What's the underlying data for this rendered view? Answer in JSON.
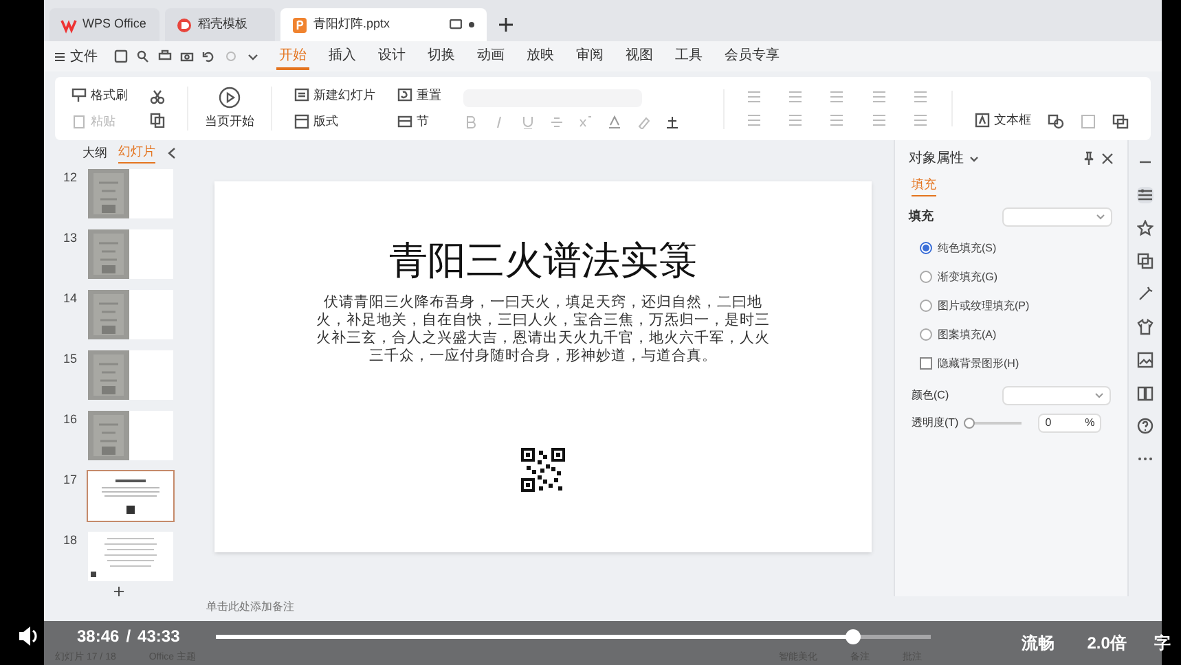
{
  "doc_tabs": [
    {
      "label": "WPS Office",
      "kind": "wps",
      "selected": false
    },
    {
      "label": "稻壳模板",
      "kind": "docer",
      "selected": false
    },
    {
      "label": "青阳灯阵.pptx",
      "kind": "pptx",
      "selected": true
    }
  ],
  "menu": {
    "file": "文件",
    "tabs": [
      {
        "label": "开始",
        "selected": true
      },
      {
        "label": "插入",
        "selected": false
      },
      {
        "label": "设计",
        "selected": false
      },
      {
        "label": "切换",
        "selected": false
      },
      {
        "label": "动画",
        "selected": false
      },
      {
        "label": "放映",
        "selected": false
      },
      {
        "label": "审阅",
        "selected": false
      },
      {
        "label": "视图",
        "selected": false
      },
      {
        "label": "工具",
        "selected": false
      },
      {
        "label": "会员专享",
        "selected": false
      }
    ]
  },
  "ribbon": {
    "format_painter": "格式刷",
    "paste": "粘贴",
    "from_current": "当页开始",
    "new_slide": "新建幻灯片",
    "layout": "版式",
    "reset": "重置",
    "section": "节",
    "text_box": "文本框"
  },
  "panel_tabs": [
    {
      "label": "大纲",
      "selected": false
    },
    {
      "label": "幻灯片",
      "selected": true
    }
  ],
  "slides": [
    {
      "number": "12",
      "selected": false
    },
    {
      "number": "13",
      "selected": false
    },
    {
      "number": "14",
      "selected": false
    },
    {
      "number": "15",
      "selected": false
    },
    {
      "number": "16",
      "selected": false
    },
    {
      "number": "17",
      "kind": "title",
      "selected": true
    },
    {
      "number": "18",
      "kind": "text",
      "selected": false
    }
  ],
  "slide": {
    "title": "青阳三火谱法实箓",
    "body": "伏请青阳三火降布吾身，一曰天火，填足天窍，还归自然，二曰地火，补足地关，自在自快，三曰人火，宝合三焦，万炁归一，是时三火补三玄，合人之兴盛大吉，恩请出天火九千官，地火六千军，人火三千众，一应付身随时合身，形神妙道，与道合真。"
  },
  "notes_placeholder": "单击此处添加备注",
  "properties": {
    "title": "对象属性",
    "tab": "填充",
    "section": "填充",
    "options": [
      {
        "label": "纯色填充(S)",
        "kind": "radio",
        "checked": true
      },
      {
        "label": "渐变填充(G)",
        "kind": "radio",
        "checked": false
      },
      {
        "label": "图片或纹理填充(P)",
        "kind": "radio",
        "checked": false
      },
      {
        "label": "图案填充(A)",
        "kind": "radio",
        "checked": false
      },
      {
        "label": "隐藏背景图形(H)",
        "kind": "checkbox",
        "checked": false
      }
    ],
    "color_label": "颜色(C)",
    "transparency_label": "透明度(T)",
    "transparency": {
      "level": 0,
      "value": "0",
      "unit": "%"
    }
  },
  "status_bar": {
    "slide_count": "幻灯片 17 / 18",
    "theme": "Office 主题",
    "beautify": "智能美化",
    "notes": "备注",
    "comments": "批注"
  },
  "player": {
    "elapsed": "38:46",
    "separator": "/",
    "duration": "43:33",
    "progress": {
      "level": 0.89
    },
    "quality": "流畅",
    "speed": "2.0倍",
    "subtitle": "字"
  }
}
